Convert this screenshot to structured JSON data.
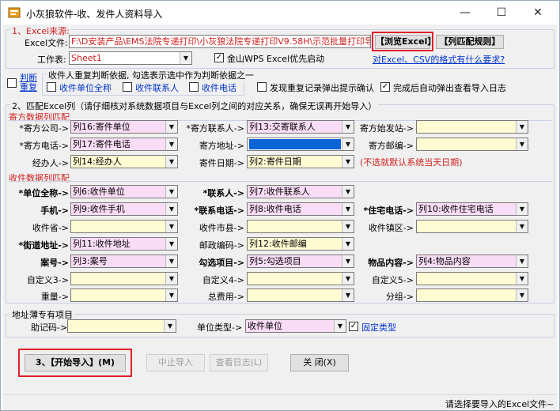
{
  "window": {
    "title": "小灰狼软件-收、发件人资料导入",
    "minimize": "—",
    "maximize": "☐",
    "close": "✕"
  },
  "excel_source": {
    "group_title": "1、Excel来源:",
    "file_label": "Excel文件:",
    "file_path": "F:\\D安装产品\\EMS法院专递打印\\小灰狼法院专递打印V9.58H\\示范批量打印导入",
    "browse_button": "【浏览Excel】",
    "mapping_button": "【列匹配规则】",
    "sheet_label": "工作表:",
    "sheet_value": "Sheet1",
    "wps_checkbox_label": "金山WPS Excel优先启动",
    "wps_checked": true,
    "help_link": "对Excel、CSV的格式有什么要求?"
  },
  "duplicate": {
    "judge_checkbox_label": "判断重复",
    "judge_checked": false,
    "group_title": "收件人重复判断依据, 勾选表示选中作为判断依据之一",
    "options": [
      {
        "label": "收件单位全称",
        "checked": false
      },
      {
        "label": "收件联系人",
        "checked": false
      },
      {
        "label": "收件电话",
        "checked": false
      }
    ],
    "confirm_label": "发现重复记录弹出提示确认",
    "confirm_checked": false,
    "show_log_label": "完成后自动弹出查看导入日志",
    "show_log_checked": true
  },
  "match": {
    "group_title": "2、匹配Excel列（请仔细核对系统数据项目与Excel列之间的对应关系，确保无误再开始导入）",
    "sender_section": "寄方数据列匹配",
    "sender_rows": [
      [
        {
          "label": "*寄方公司->",
          "value": "列16:寄件单位",
          "style": "pink"
        },
        {
          "label": "*寄方联系人->",
          "value": "列13:交寄联系人",
          "style": "pink"
        },
        {
          "label": "寄方始发站->",
          "value": "",
          "style": "yellow"
        }
      ],
      [
        {
          "label": "*寄方电话->",
          "value": "列17:寄件电话",
          "style": "pink"
        },
        {
          "label": "寄方地址->",
          "value": "",
          "style": "selected"
        },
        {
          "label": "寄方邮编->",
          "value": "",
          "style": "yellow"
        }
      ],
      [
        {
          "label": "经办人->",
          "value": "列14:经办人",
          "style": "yellow"
        },
        {
          "label": "寄件日期->",
          "value": "列2:寄件日期",
          "style": "yellow"
        }
      ]
    ],
    "date_note": "(不选就默认系统当天日期)",
    "receiver_section": "收件数据列匹配",
    "receiver_rows": [
      [
        {
          "label": "*单位全称->",
          "value": "列6:收件单位",
          "style": "pink",
          "bold": true
        },
        {
          "label": "*联系人->",
          "value": "列7:收件联系人",
          "style": "pink",
          "bold": true
        },
        {
          "label": "",
          "value": "",
          "style": "none"
        }
      ],
      [
        {
          "label": "手机->",
          "value": "列9:收件手机",
          "style": "pink",
          "bold": true
        },
        {
          "label": "*联系电话->",
          "value": "列8:收件电话",
          "style": "pink",
          "bold": true
        },
        {
          "label": "*住宅电话->",
          "value": "列10:收件住宅电话",
          "style": "pink",
          "bold": true
        }
      ],
      [
        {
          "label": "收件省->",
          "value": "",
          "style": "yellow"
        },
        {
          "label": "收件市县->",
          "value": "",
          "style": "yellow"
        },
        {
          "label": "收件镇区->",
          "value": "",
          "style": "yellow"
        }
      ],
      [
        {
          "label": "*街道地址->",
          "value": "列11:收件地址",
          "style": "pink",
          "bold": true
        },
        {
          "label": "邮政编码->",
          "value": "列12:收件邮编",
          "style": "yellow"
        },
        {
          "label": "",
          "value": "",
          "style": "none"
        }
      ],
      [
        {
          "label": "案号->",
          "value": "列3:案号",
          "style": "pink",
          "bold": true
        },
        {
          "label": "勾选项目->",
          "value": "列5:勾选项目",
          "style": "pink",
          "bold": true
        },
        {
          "label": "物品内容->",
          "value": "列4:物品内容",
          "style": "pink",
          "bold": true
        }
      ],
      [
        {
          "label": "自定义3->",
          "value": "",
          "style": "yellow"
        },
        {
          "label": "自定义4->",
          "value": "",
          "style": "yellow"
        },
        {
          "label": "自定义5->",
          "value": "",
          "style": "yellow"
        }
      ],
      [
        {
          "label": "重量->",
          "value": "",
          "style": "yellow"
        },
        {
          "label": "总费用->",
          "value": "",
          "style": "yellow"
        },
        {
          "label": "分组->",
          "value": "",
          "style": "yellow"
        }
      ]
    ]
  },
  "address_book": {
    "group_title": "地址薄专有项目",
    "memo_label": "助记码->",
    "memo_value": "",
    "type_label": "单位类型->",
    "type_value": "收件单位",
    "fixed_label": "固定类型",
    "fixed_checked": true
  },
  "actions": {
    "start": "3、【开始导入】(M)",
    "stop": "中止导入",
    "view_log": "查看日志(L)",
    "close": "关  闭(X)"
  },
  "status": "请选择要导入的Excel文件~",
  "colors": {
    "red_label": "#d02020",
    "pink_field": "#f9dcf6",
    "yellow_field": "#fffbd3",
    "highlight_box": "#e0202c",
    "link": "#0033cc"
  }
}
